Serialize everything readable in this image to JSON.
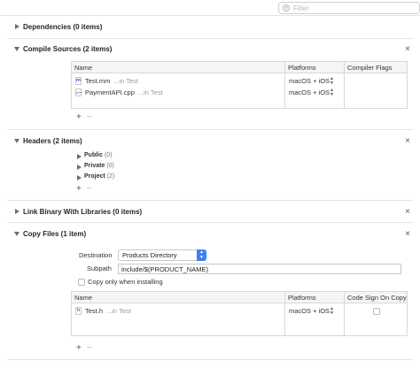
{
  "filter": {
    "placeholder": "Filter"
  },
  "phases": {
    "dependencies": {
      "title": "Dependencies (0 items)"
    },
    "compile_sources": {
      "title": "Compile Sources (2 items)",
      "columns": [
        "Name",
        "Platforms",
        "Compiler Flags"
      ],
      "rows": [
        {
          "icon": "m",
          "name": "Test.mm",
          "location": "...in Test",
          "platforms": "macOS + iOS"
        },
        {
          "icon": "c++",
          "name": "PaymentAPI.cpp",
          "location": "...in Test",
          "platforms": "macOS + iOS"
        }
      ]
    },
    "headers": {
      "title": "Headers (2 items)",
      "groups": [
        {
          "name": "Public",
          "count": "(0)"
        },
        {
          "name": "Private",
          "count": "(0)"
        },
        {
          "name": "Project",
          "count": "(2)"
        }
      ]
    },
    "link_binary": {
      "title": "Link Binary With Libraries (0 items)"
    },
    "copy_files": {
      "title": "Copy Files (1 item)",
      "destination_label": "Destination",
      "destination_value": "Products Directory",
      "subpath_label": "Subpath",
      "subpath_value": "include/$(PRODUCT_NAME)",
      "copy_only_label": "Copy only when installing",
      "columns": [
        "Name",
        "Platforms",
        "Code Sign On Copy"
      ],
      "rows": [
        {
          "icon": "h",
          "name": "Test.h",
          "location": "...in Test",
          "platforms": "macOS + iOS"
        }
      ]
    }
  },
  "controls": {
    "add": "+",
    "remove": "−",
    "close": "×"
  },
  "colors": {
    "accent": "#3b82f6",
    "m_icon": "#3b5bdb",
    "cpp_icon": "#7b61c9",
    "h_icon": "#d64545"
  }
}
